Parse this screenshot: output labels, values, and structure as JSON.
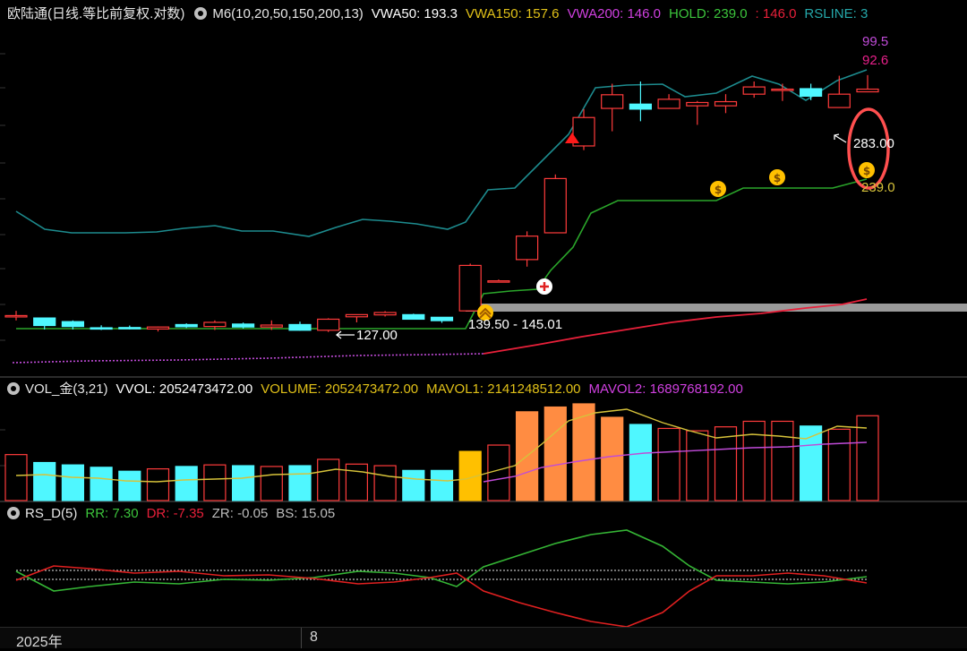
{
  "header_main": {
    "title": "欧陆通(日线.等比前复权.对数)",
    "m6": "M6(10,20,50,150,200,13)",
    "vwa50": "VWA50: 193.3",
    "vwa150": "VWA150: 157.6",
    "vwa200": "VWA200: 146.0",
    "hold": "HOLD: 239.0",
    "colon146": ": 146.0",
    "rsline": "RSLINE: 3"
  },
  "header_vol": {
    "title": "VOL_金(3,21)",
    "vvol": "VVOL: 2052473472.00",
    "volume": "VOLUME: 2052473472.00",
    "mavol1": "MAVOL1: 2141248512.00",
    "mavol2": "MAVOL2: 1689768192.00"
  },
  "header_rs": {
    "title": "RS_D(5)",
    "rr": "RR: 7.30",
    "dr": "DR: -7.35",
    "zr": "ZR: -0.05",
    "bs": "BS: 15.05"
  },
  "labels": {
    "low_price": "127.00",
    "range": "139.50 - 145.01",
    "high_price": "283.00",
    "hold_value": "239.0",
    "rsline_top": "99.5",
    "rsline_second": "92.6"
  },
  "axis": {
    "year": "2025年",
    "month": "8"
  },
  "colors": {
    "up": "#ff3b3b",
    "down": "#4ff7ff",
    "teal": "#1d8b8e",
    "green": "#2aa52a",
    "red": "#e8203a",
    "purple": "#c04bd8",
    "yellow": "#d6c23a",
    "orange": "#ff8c42",
    "gold": "#ffc000",
    "gray_band": "#9a9a9a"
  },
  "chart_data": {
    "type": "candlestick",
    "candles": [
      {
        "o": 131.5,
        "h": 133.5,
        "l": 129.5,
        "c": 131.5
      },
      {
        "o": 130.5,
        "h": 128.5,
        "l": 125.8,
        "c": 127.4
      },
      {
        "o": 129.0,
        "h": 129.5,
        "l": 125.8,
        "c": 127.0
      },
      {
        "o": 126.5,
        "h": 127.5,
        "l": 125.6,
        "c": 126.3
      },
      {
        "o": 126.6,
        "h": 127.4,
        "l": 125.8,
        "c": 126.3
      },
      {
        "o": 126.0,
        "h": 127.0,
        "l": 125.0,
        "c": 126.8
      },
      {
        "o": 127.8,
        "h": 128.3,
        "l": 126.4,
        "c": 126.9
      },
      {
        "o": 127.0,
        "h": 129.5,
        "l": 125.6,
        "c": 128.7
      },
      {
        "o": 128.0,
        "h": 128.6,
        "l": 126.2,
        "c": 126.8
      },
      {
        "o": 126.8,
        "h": 129.5,
        "l": 125.6,
        "c": 127.6
      },
      {
        "o": 127.8,
        "h": 129.0,
        "l": 125.3,
        "c": 125.5
      },
      {
        "o": 125.5,
        "h": 130.4,
        "l": 124.8,
        "c": 130.0
      },
      {
        "o": 131.0,
        "h": 132.0,
        "l": 128.7,
        "c": 131.9
      },
      {
        "o": 131.8,
        "h": 133.4,
        "l": 131.1,
        "c": 132.8
      },
      {
        "o": 131.9,
        "h": 132.3,
        "l": 129.8,
        "c": 130.0
      },
      {
        "o": 130.8,
        "h": 130.8,
        "l": 128.5,
        "c": 129.4
      },
      {
        "o": 133.5,
        "h": 155.2,
        "l": 133.5,
        "c": 154.3
      },
      {
        "o": 146.9,
        "h": 147.5,
        "l": 147.5,
        "c": 146.9
      },
      {
        "o": 157.2,
        "h": 172.0,
        "l": 153.7,
        "c": 169.4
      },
      {
        "o": 171.2,
        "h": 206.2,
        "l": 171.2,
        "c": 203.5
      },
      {
        "o": 225.8,
        "h": 253.9,
        "l": 222.8,
        "c": 247.2
      },
      {
        "o": 254.5,
        "h": 275.3,
        "l": 236.6,
        "c": 265.8
      },
      {
        "o": 258.0,
        "h": 277.3,
        "l": 244.3,
        "c": 253.9
      },
      {
        "o": 254.5,
        "h": 266.3,
        "l": 258.6,
        "c": 262.0
      },
      {
        "o": 256.6,
        "h": 260.6,
        "l": 241.5,
        "c": 259.3
      },
      {
        "o": 256.6,
        "h": 266.3,
        "l": 250.7,
        "c": 260.0
      },
      {
        "o": 266.3,
        "h": 277.3,
        "l": 263.3,
        "c": 272.5
      },
      {
        "o": 270.6,
        "h": 275.3,
        "l": 260.6,
        "c": 270.6
      },
      {
        "o": 271.0,
        "h": 275.3,
        "l": 261.3,
        "c": 264.6
      },
      {
        "o": 255.2,
        "h": 282.4,
        "l": 255.2,
        "c": 266.3
      },
      {
        "o": 268.3,
        "h": 283.0,
        "l": 268.3,
        "c": 270.6
      }
    ],
    "volume": [
      58,
      48,
      45,
      42,
      37,
      40,
      43,
      45,
      44,
      43,
      44,
      52,
      46,
      44,
      38,
      38,
      62,
      70,
      112,
      118,
      122,
      105,
      96,
      91,
      88,
      93,
      100,
      100,
      94,
      90,
      107
    ],
    "price_axis": {
      "min": 110,
      "max": 330,
      "scale": "log"
    }
  }
}
